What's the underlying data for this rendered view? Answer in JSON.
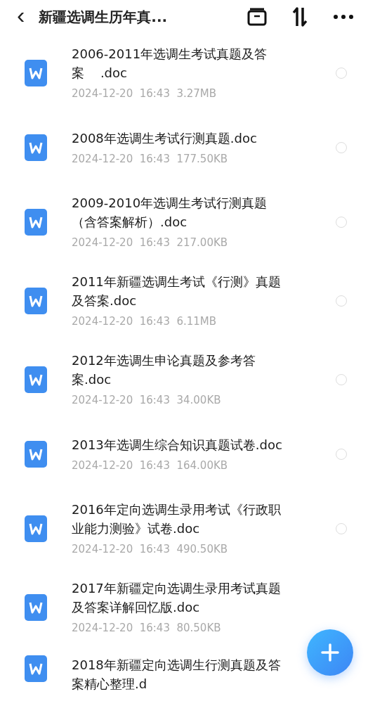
{
  "header": {
    "back": "‹",
    "title": "新疆选调生历年真..."
  },
  "files": [
    {
      "lines": [
        "2006-2011年选调生考试真题及答",
        "案    .doc"
      ],
      "date": "2024-12-20",
      "time": "16:43",
      "size": "3.27MB",
      "selected": false
    },
    {
      "lines": [
        "2008年选调生考试行测真题.doc"
      ],
      "date": "2024-12-20",
      "time": "16:43",
      "size": "177.50KB",
      "selected": false
    },
    {
      "lines": [
        "2009-2010年选调生考试行测真题",
        "（含答案解析）.doc"
      ],
      "date": "2024-12-20",
      "time": "16:43",
      "size": "217.00KB",
      "selected": false
    },
    {
      "lines": [
        "2011年新疆选调生考试《行测》真题",
        "及答案.doc"
      ],
      "date": "2024-12-20",
      "time": "16:43",
      "size": "6.11MB",
      "selected": false
    },
    {
      "lines": [
        "2012年选调生申论真题及参考答",
        "案.doc"
      ],
      "date": "2024-12-20",
      "time": "16:43",
      "size": "34.00KB",
      "selected": false
    },
    {
      "lines": [
        "2013年选调生综合知识真题试卷.doc"
      ],
      "date": "2024-12-20",
      "time": "16:43",
      "size": "164.00KB",
      "selected": false
    },
    {
      "lines": [
        "2016年定向选调生录用考试《行政职",
        "业能力测验》试卷.doc"
      ],
      "date": "2024-12-20",
      "time": "16:43",
      "size": "490.50KB",
      "selected": false
    },
    {
      "lines": [
        "2017年新疆定向选调生录用考试真题",
        "及答案详解回忆版.doc"
      ],
      "date": "2024-12-20",
      "time": "16:43",
      "size": "80.50KB"
    },
    {
      "lines": [
        "2018年新疆定向选调生行测真题及答",
        "案精心整理.d"
      ]
    }
  ]
}
